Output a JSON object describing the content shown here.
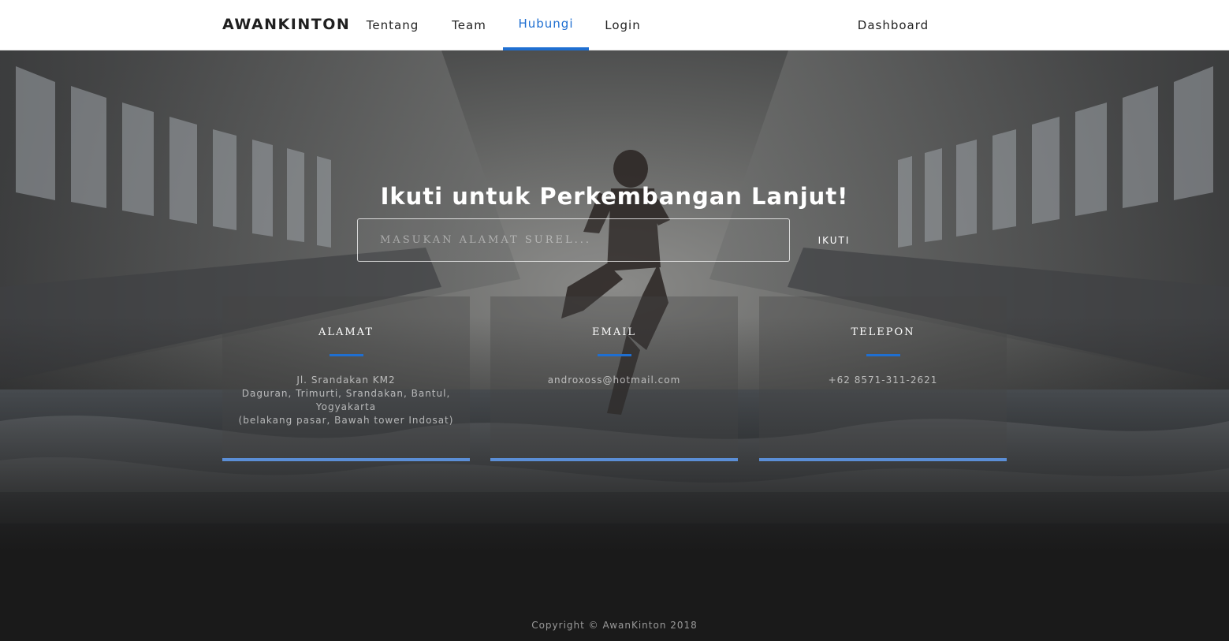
{
  "nav": {
    "brand": "AWANKINTON",
    "items": [
      {
        "label": "Tentang"
      },
      {
        "label": "Team"
      },
      {
        "label": "Hubungi",
        "active": true
      },
      {
        "label": "Login"
      }
    ],
    "dashboard": "Dashboard"
  },
  "subscribe": {
    "title": "Ikuti untuk Perkembangan Lanjut!",
    "placeholder": "MASUKAN ALAMAT SUREL...",
    "button": "IKUTI"
  },
  "contact": {
    "alamat": {
      "title": "ALAMAT",
      "lines": [
        "Jl. Srandakan KM2",
        "Daguran, Trimurti, Srandakan, Bantul,",
        "Yogyakarta",
        "(belakang pasar, Bawah tower Indosat)"
      ]
    },
    "email": {
      "title": "EMAIL",
      "value": "androxoss@hotmail.com"
    },
    "telepon": {
      "title": "TELEPON",
      "value": "+62 8571-311-2621"
    }
  },
  "footer": {
    "copyright": "Copyright © AwanKinton 2018"
  },
  "colors": {
    "accent": "#1f6fd1",
    "card_border": "#5b8ed6",
    "footer_bg": "#1a1a1a"
  }
}
